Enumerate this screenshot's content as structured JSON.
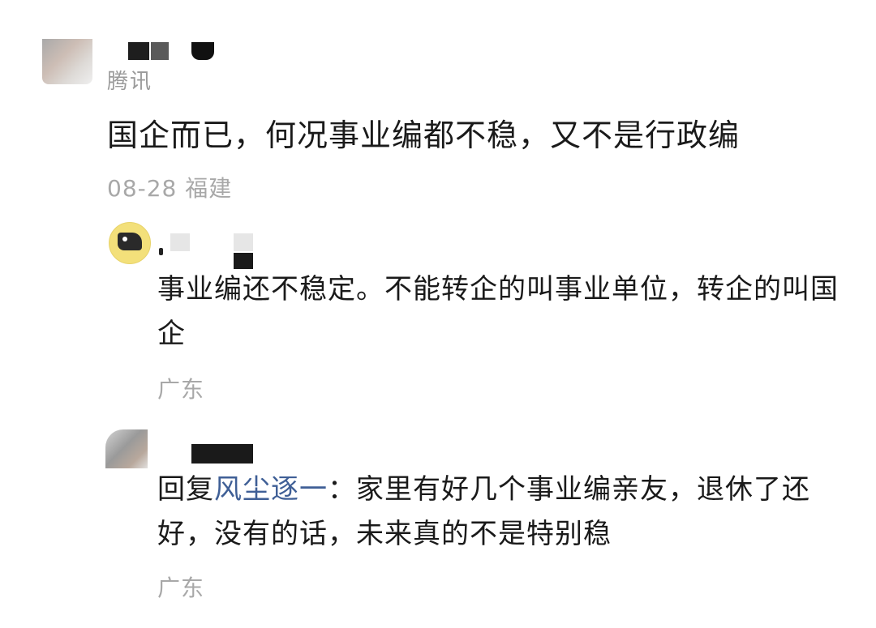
{
  "comment": {
    "company": "腾讯",
    "text": "国企而已，何况事业编都不稳，又不是行政编",
    "date": "08-28",
    "location": "福建"
  },
  "replies": [
    {
      "text": "事业编还不稳定。不能转企的叫事业单位，转企的叫国企",
      "location": "广东"
    },
    {
      "reply_prefix": "回复",
      "reply_to": "风尘逐一",
      "separator": "：",
      "text": "家里有好几个事业编亲友，退休了还好，没有的话，未来真的不是特别稳",
      "location": "广东"
    }
  ],
  "colors": {
    "text": "#1a1a1a",
    "meta": "#a8a8a8",
    "link": "#3f5f96"
  }
}
